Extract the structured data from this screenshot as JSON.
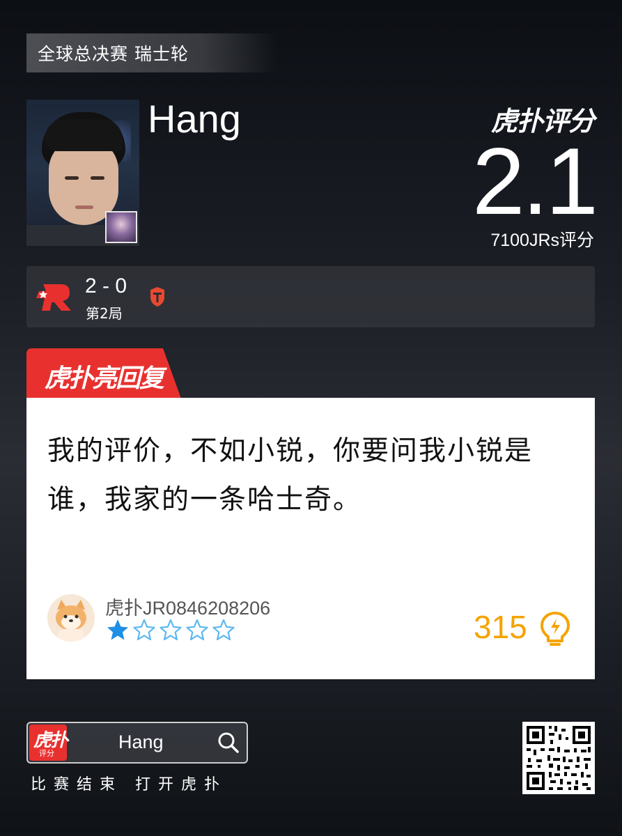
{
  "event": {
    "title": "全球总决赛 瑞士轮"
  },
  "player": {
    "name": "Hang",
    "photo_icon": "player-photo",
    "champion_icon": "champion-portrait-icon"
  },
  "rating": {
    "brand": "虎扑评分",
    "score": "2.1",
    "count_label": "7100JRs评分"
  },
  "match": {
    "team_left_icon": "krx-team-logo-icon",
    "score": "2 - 0",
    "game": "第2局",
    "team_right_icon": "tes-team-logo-icon"
  },
  "reply": {
    "header_label": "虎扑亮回复",
    "header_color": "#e8312f",
    "text": "我的评价，不如小锐，你要问我小锐是谁，我家的一条哈士奇。",
    "user": {
      "avatar_icon": "shiba-avatar-icon",
      "name": "虎扑JR0846208206"
    },
    "stars": {
      "filled": 1,
      "total": 5,
      "color": "#1e8fe6"
    },
    "likes": "315",
    "likes_color": "#f5a300"
  },
  "footer": {
    "app_icon_text": "虎扑",
    "app_icon_sub": "评分",
    "search_term": "Hang",
    "caption": "比赛结束 打开虎扑",
    "qr_icon": "qr-code-icon"
  }
}
